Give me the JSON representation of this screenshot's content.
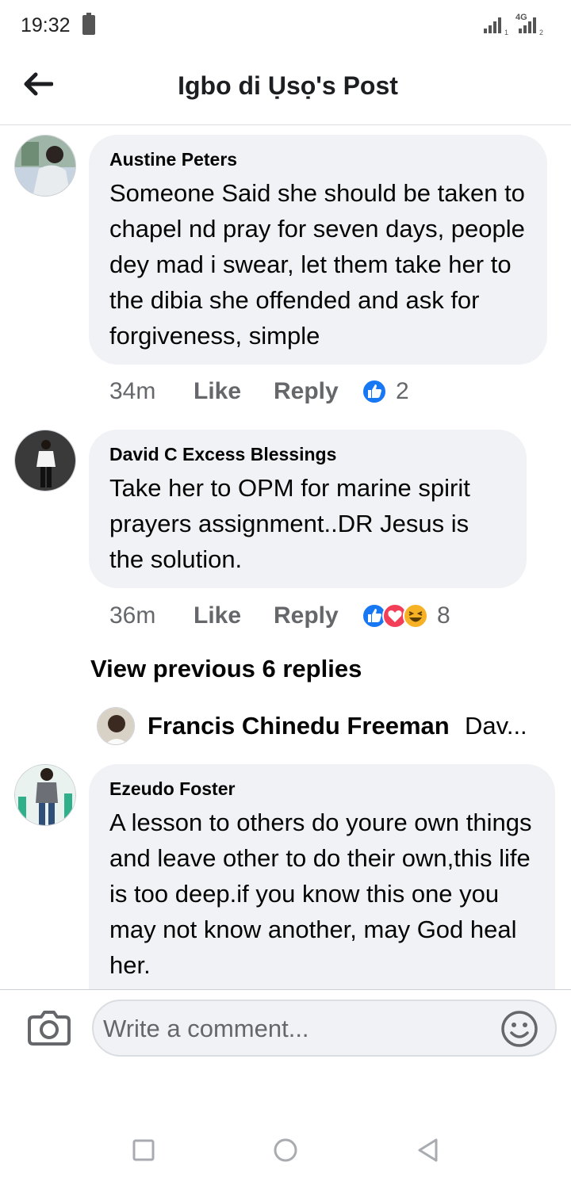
{
  "status_bar": {
    "time": "19:32",
    "signal_label_1": "1",
    "network_type": "4G",
    "signal_label_2": "2"
  },
  "header": {
    "title": "Igbo di Ụsọ's Post",
    "back_icon": "arrow-left-icon"
  },
  "comments": [
    {
      "author": "Austine Peters",
      "text": "Someone Said she should be taken to chapel nd pray for seven days, people dey mad i swear, let them take her to the dibia she offended and ask for forgiveness, simple",
      "time": "34m",
      "like_label": "Like",
      "reply_label": "Reply",
      "reactions": [
        "like"
      ],
      "reaction_count": "2"
    },
    {
      "author": "David C Excess Blessings",
      "text": "Take her to OPM for marine spirit prayers assignment..DR Jesus is the solution.",
      "time": "36m",
      "like_label": "Like",
      "reply_label": "Reply",
      "reactions": [
        "like",
        "love",
        "haha"
      ],
      "reaction_count": "8"
    },
    {
      "author": "Ezeudo Foster",
      "text": "A lesson to others do youre own things and leave other to do their own,this life is too deep.if you know this one you may not know another, may God heal her."
    }
  ],
  "replies": {
    "view_previous": "View previous 6 replies",
    "preview_author": "Francis Chinedu Freeman",
    "preview_snippet": "Dav..."
  },
  "composer": {
    "placeholder": "Write a comment...",
    "camera_icon": "camera-icon",
    "emoji_icon": "smiley-icon"
  },
  "nav_bar": {
    "icons": [
      "recent-apps-icon",
      "home-icon",
      "back-triangle-icon"
    ]
  },
  "colors": {
    "bubble": "#f0f2f5",
    "secondary_text": "#65676b",
    "like_blue": "#1877f2",
    "love_red": "#f33e58",
    "haha_yellow": "#f7b125"
  }
}
